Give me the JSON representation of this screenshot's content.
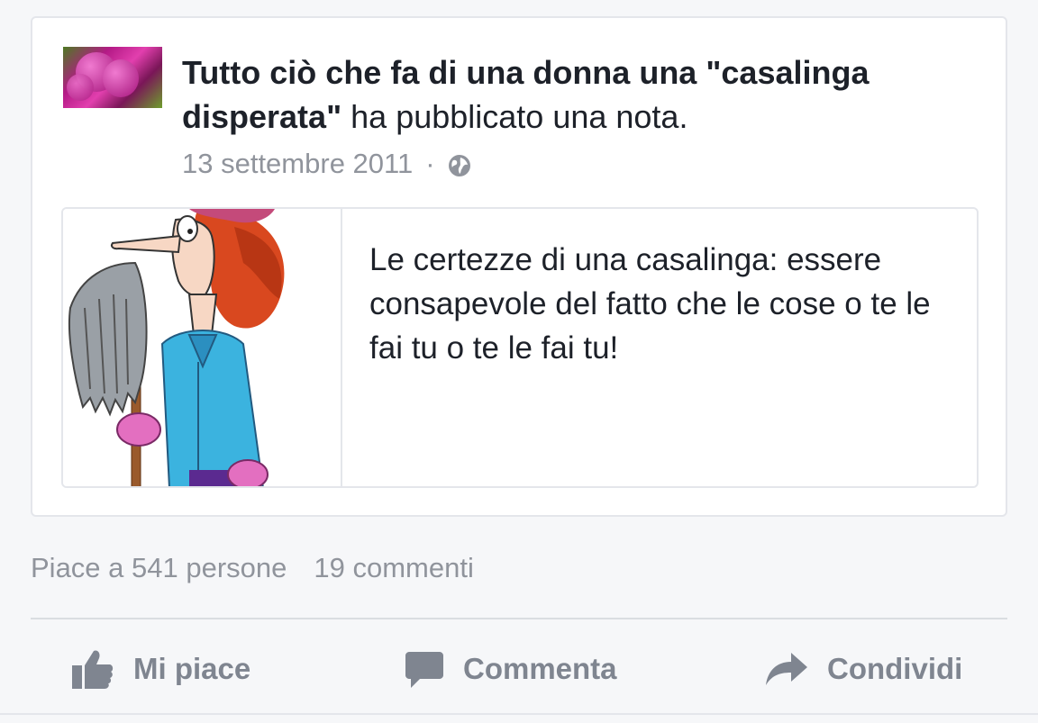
{
  "post": {
    "page_name": "Tutto ciò che fa di una donna una \"casalinga disperata\"",
    "action_text": " ha pubblicato una nota.",
    "date": "13 settembre 2011",
    "separator": "·",
    "privacy_icon": "globe-icon",
    "avatar_icon": "tulip-photo"
  },
  "note": {
    "image_icon": "housewife-with-mop-cartoon",
    "text": "Le certezze di una casalinga: essere consapevole del fatto che le cose o te le fai tu o te le fai tu!"
  },
  "stats": {
    "likes": "Piace a 541 persone",
    "comments": "19 commenti"
  },
  "actions": {
    "like": "Mi piace",
    "comment": "Commenta",
    "share": "Condividi"
  },
  "colors": {
    "text_primary": "#1d2129",
    "text_secondary": "#90949c",
    "action_gray": "#7f8590",
    "border": "#e4e6eb",
    "background": "#f6f7f9"
  }
}
